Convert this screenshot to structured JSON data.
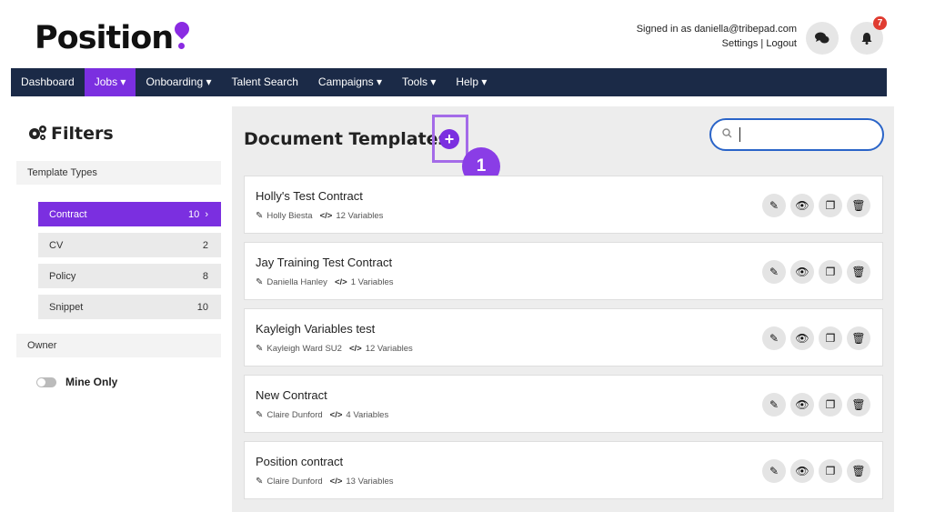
{
  "header": {
    "logo_text": "Position",
    "signed_in_text": "Signed in as daniella@tribepad.com",
    "settings_link": "Settings",
    "separator": "|",
    "logout_link": "Logout",
    "notification_count": "7"
  },
  "nav": {
    "items": [
      {
        "label": "Dashboard"
      },
      {
        "label": "Jobs ▾"
      },
      {
        "label": "Onboarding ▾"
      },
      {
        "label": "Talent Search"
      },
      {
        "label": "Campaigns ▾"
      },
      {
        "label": "Tools ▾"
      },
      {
        "label": "Help ▾"
      }
    ]
  },
  "sidebar": {
    "title": "Filters",
    "template_types_label": "Template Types",
    "types": [
      {
        "label": "Contract",
        "count": "10",
        "chevron": "›"
      },
      {
        "label": "CV",
        "count": "2"
      },
      {
        "label": "Policy",
        "count": "8"
      },
      {
        "label": "Snippet",
        "count": "10"
      }
    ],
    "owner_label": "Owner",
    "mine_only_label": "Mine Only"
  },
  "main": {
    "title": "Document Templates",
    "add_symbol": "+",
    "callout_number": "1",
    "search_placeholder": "",
    "templates": [
      {
        "name": "Holly's Test Contract",
        "author": "Holly Biesta",
        "variables": "12 Variables"
      },
      {
        "name": "Jay Training Test Contract",
        "author": "Daniella Hanley",
        "variables": "1 Variables"
      },
      {
        "name": "Kayleigh Variables test",
        "author": "Kayleigh Ward SU2",
        "variables": "12 Variables"
      },
      {
        "name": "New Contract",
        "author": "Claire Dunford",
        "variables": "4 Variables"
      },
      {
        "name": "Position contract",
        "author": "Claire Dunford",
        "variables": "13 Variables"
      }
    ]
  },
  "colors": {
    "brand_purple": "#7b2fe0",
    "nav_bg": "#1b2a47",
    "badge_red": "#e03c31",
    "search_border": "#2a64c8"
  }
}
